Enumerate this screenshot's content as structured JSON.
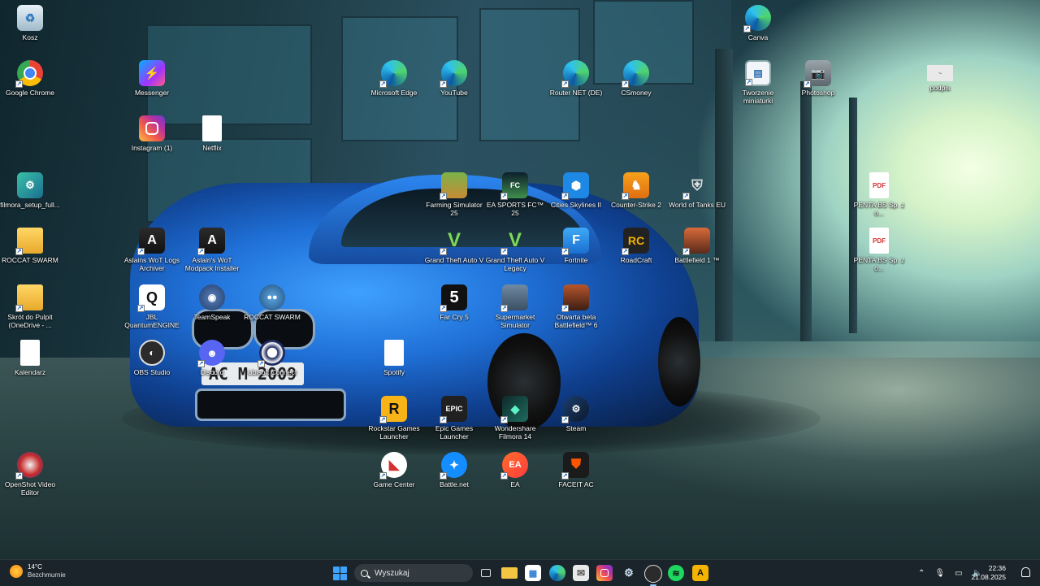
{
  "desktop": {
    "icons": [
      {
        "label": "Kosz",
        "icon": "recycle-bin-icon"
      },
      {
        "label": "Google Chrome",
        "icon": "chrome-icon"
      },
      {
        "label": "filmora_setup_full...",
        "icon": "installer-icon"
      },
      {
        "label": "ROCCAT SWARM",
        "icon": "folder-icon"
      },
      {
        "label": "Skrót do Pulpit (OneDrive - ...",
        "icon": "folder-icon"
      },
      {
        "label": "Kalendarz",
        "icon": "document-icon"
      },
      {
        "label": "OpenShot Video Editor",
        "icon": "openshot-icon"
      },
      {
        "label": "Messenger",
        "icon": "messenger-icon"
      },
      {
        "label": "Instagram (1)",
        "icon": "instagram-icon"
      },
      {
        "label": "Netflix",
        "icon": "document-icon"
      },
      {
        "label": "Aslains WoT Logs Archiver",
        "icon": "aslain-icon"
      },
      {
        "label": "Aslain's WoT Modpack Installer",
        "icon": "aslain-icon"
      },
      {
        "label": "JBL QuantumENGINE",
        "icon": "jbl-icon"
      },
      {
        "label": "TeamSpeak",
        "icon": "teamspeak-icon"
      },
      {
        "label": "ROCCAT SWARM",
        "icon": "roccat-icon"
      },
      {
        "label": "OBS Studio",
        "icon": "obs-icon"
      },
      {
        "label": "Discord",
        "icon": "discord-icon"
      },
      {
        "label": "Ubisoft Connect",
        "icon": "ubisoft-icon"
      },
      {
        "label": "Microsoft Edge",
        "icon": "edge-icon"
      },
      {
        "label": "YouTube",
        "icon": "edge-icon"
      },
      {
        "label": "Router NET (DE)",
        "icon": "edge-icon"
      },
      {
        "label": "CSmoney",
        "icon": "edge-icon"
      },
      {
        "label": "Canva",
        "icon": "edge-icon"
      },
      {
        "label": "Tworzenie miniaturki",
        "icon": "thumbnail-icon"
      },
      {
        "label": "Photoshop",
        "icon": "camera-icon"
      },
      {
        "label": "podpis",
        "icon": "signature-image-icon"
      },
      {
        "label": "Farming Simulator 25",
        "icon": "game-icon"
      },
      {
        "label": "EA SPORTS FC™ 25",
        "icon": "game-icon"
      },
      {
        "label": "Cities Skylines II",
        "icon": "game-icon"
      },
      {
        "label": "Counter-Strike 2",
        "icon": "cs2-icon"
      },
      {
        "label": "World of Tanks EU",
        "icon": "wot-icon"
      },
      {
        "label": "PENTA BS Sp. z o...",
        "icon": "pdf-icon"
      },
      {
        "label": "Grand Theft Auto V",
        "icon": "gta-icon"
      },
      {
        "label": "Grand Theft Auto V Legacy",
        "icon": "gta-icon"
      },
      {
        "label": "Fortnite",
        "icon": "fortnite-icon"
      },
      {
        "label": "RoadCraft",
        "icon": "roadcraft-icon"
      },
      {
        "label": "Battlefield 1 ™",
        "icon": "game-icon"
      },
      {
        "label": "PENTA BS Sp. z o...",
        "icon": "pdf-icon"
      },
      {
        "label": "Far Cry 5",
        "icon": "farcry-icon"
      },
      {
        "label": "Supermarket Simulator",
        "icon": "game-icon"
      },
      {
        "label": "Otwarta beta Battlefield™ 6",
        "icon": "game-icon"
      },
      {
        "label": "Spotify",
        "icon": "document-icon"
      },
      {
        "label": "Rockstar Games Launcher",
        "icon": "rockstar-icon"
      },
      {
        "label": "Epic Games Launcher",
        "icon": "epic-icon"
      },
      {
        "label": "Wondershare Filmora 14",
        "icon": "filmora-icon"
      },
      {
        "label": "Steam",
        "icon": "steam-icon"
      },
      {
        "label": "Game Center",
        "icon": "game-center-icon"
      },
      {
        "label": "Battle.net",
        "icon": "battlenet-icon"
      },
      {
        "label": "EA",
        "icon": "ea-icon"
      },
      {
        "label": "FACEIT AC",
        "icon": "faceit-icon"
      }
    ],
    "wallpaper_plate": "AC M 2009"
  },
  "taskbar": {
    "weather": {
      "temp": "14°C",
      "condition": "Bezchmurnie",
      "icon": "sun-icon"
    },
    "search_placeholder": "Wyszukaj",
    "pinned": [
      "task-view-icon",
      "file-explorer-icon",
      "store-icon",
      "edge-icon",
      "mail-icon",
      "instagram-icon",
      "steam-icon",
      "obs-icon",
      "spotify-icon",
      "aslain-icon"
    ],
    "clock": {
      "time": "22:36",
      "date": "21.08.2025"
    },
    "colors": {
      "accent": "#3ea3ff",
      "taskbar": "#1c242a"
    }
  }
}
